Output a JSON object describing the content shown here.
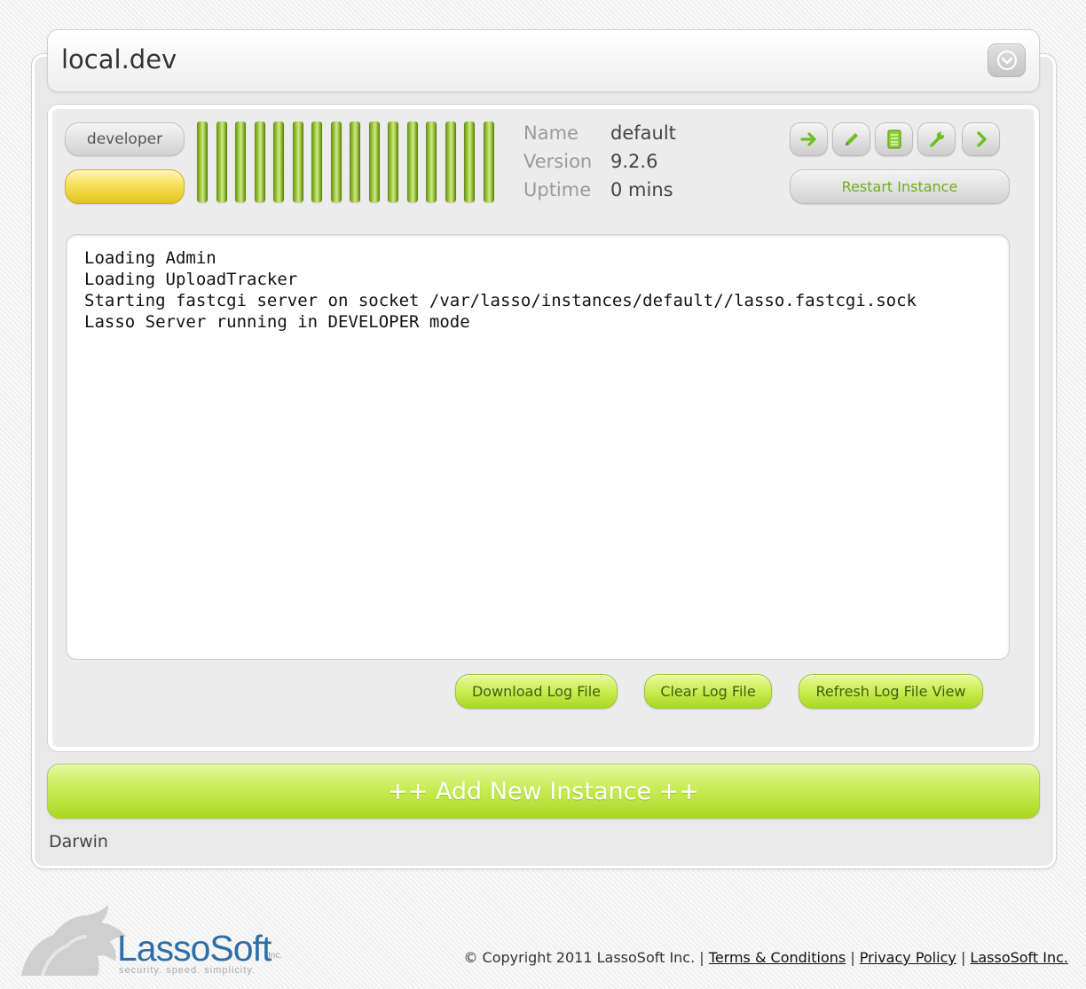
{
  "host": {
    "title": "local.dev",
    "collapse_icon": "chevron-down-icon"
  },
  "instance": {
    "mode_badge": "developer",
    "status_color": "#f0d53a",
    "meter": {
      "total_segments": 16,
      "active_segments": 16,
      "color": "#8ab52a"
    },
    "info": [
      {
        "label": "Name",
        "value": "default"
      },
      {
        "label": "Version",
        "value": "9.2.6"
      },
      {
        "label": "Uptime",
        "value": "0 mins"
      }
    ],
    "action_icons": [
      "arrow-right-icon",
      "pencil-icon",
      "document-icon",
      "wrench-icon",
      "chevron-right-icon"
    ],
    "restart_label": "Restart Instance",
    "log_lines": [
      "Loading Admin",
      "Loading UploadTracker",
      "Starting fastcgi server on socket /var/lasso/instances/default//lasso.fastcgi.sock",
      "Lasso Server running in DEVELOPER mode"
    ],
    "buttons": {
      "download_log": "Download Log File",
      "clear_log": "Clear Log File",
      "refresh_log": "Refresh Log File View"
    }
  },
  "add_instance_label": "++ Add New Instance ++",
  "os_label": "Darwin",
  "footer": {
    "logo_text": "LassoSoft",
    "logo_suffix": "Inc.",
    "logo_tagline": "security. speed. simplicity.",
    "copyright": "© Copyright 2011 LassoSoft Inc.",
    "separator": "|",
    "links": [
      "Terms & Conditions",
      "Privacy Policy",
      "LassoSoft Inc."
    ]
  },
  "colors": {
    "accent_green": "#b4dc2e",
    "status_yellow": "#f0d53a",
    "brand_blue": "#2f6fa7"
  }
}
